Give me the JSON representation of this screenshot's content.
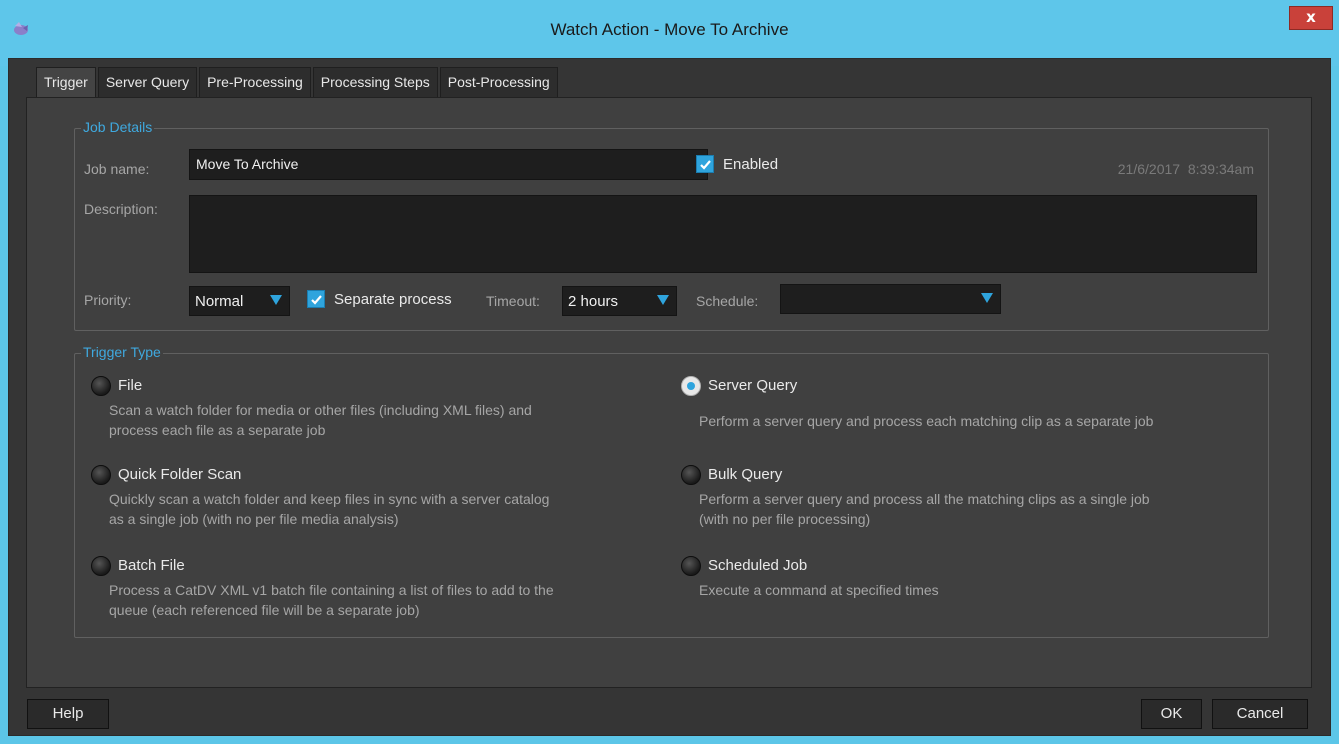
{
  "window": {
    "title": "Watch Action - Move To Archive",
    "close_glyph": "x"
  },
  "tabs": [
    {
      "label": "Trigger",
      "active": true
    },
    {
      "label": "Server Query",
      "active": false
    },
    {
      "label": "Pre-Processing",
      "active": false
    },
    {
      "label": "Processing Steps",
      "active": false
    },
    {
      "label": "Post-Processing",
      "active": false
    }
  ],
  "job_details": {
    "legend": "Job Details",
    "job_name_label": "Job name:",
    "job_name_value": "Move To Archive",
    "enabled_label": "Enabled",
    "enabled_checked": true,
    "timestamp": "21/6/2017  8:39:34am",
    "description_label": "Description:",
    "description_value": "",
    "priority_label": "Priority:",
    "priority_value": "Normal",
    "separate_process_label": "Separate process",
    "separate_process_checked": true,
    "timeout_label": "Timeout:",
    "timeout_value": "2 hours",
    "schedule_label": "Schedule:",
    "schedule_value": ""
  },
  "trigger_type": {
    "legend": "Trigger Type",
    "options": [
      {
        "label": "File",
        "selected": false,
        "desc1": "Scan a watch folder for media or other files (including XML files) and",
        "desc2": "process each file as a separate job"
      },
      {
        "label": "Server Query",
        "selected": true,
        "desc1": "Perform a server query and process each matching clip as a separate job",
        "desc2": ""
      },
      {
        "label": "Quick Folder Scan",
        "selected": false,
        "desc1": "Quickly scan a watch folder and keep files in sync with a server catalog",
        "desc2": "as a single job (with no per file media analysis)"
      },
      {
        "label": "Bulk Query",
        "selected": false,
        "desc1": "Perform a server query and process all the matching clips as a single job",
        "desc2": "(with no per file processing)"
      },
      {
        "label": "Batch File",
        "selected": false,
        "desc1": "Process a CatDV XML v1 batch file containing a list of files to add to the",
        "desc2": "queue (each referenced file will be a separate job)"
      },
      {
        "label": "Scheduled Job",
        "selected": false,
        "desc1": "Execute a command at specified times",
        "desc2": ""
      }
    ]
  },
  "buttons": {
    "help": "Help",
    "ok": "OK",
    "cancel": "Cancel"
  },
  "colors": {
    "titlebar": "#5ec6ea",
    "accent": "#2fa4dd",
    "legend": "#3fa9df",
    "close": "#c9413a"
  }
}
